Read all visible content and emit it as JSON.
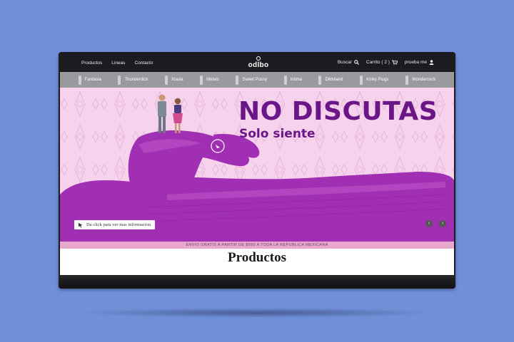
{
  "nav": {
    "links": [
      "Productos",
      "Lineas",
      "Contacto"
    ],
    "logo": "odlbo",
    "search_label": "Buscar",
    "cart_label": "Carrito ( 2 )",
    "user_label": "prueba me"
  },
  "categories": [
    "Fantasia",
    "Thunderdick",
    "Xtasia",
    "Metals",
    "Sweet Pussy",
    "Intima",
    "Dildoland",
    "Kinky Plugs",
    "Wondercock"
  ],
  "hero": {
    "headline": "NO DISCUTAS",
    "subhead": "Solo siente",
    "cta_label": "Da click para ver mas informacion",
    "prev_arrow": "‹",
    "next_arrow": "›"
  },
  "shipping_banner": "ENVIO GRATIS A PARTIR DE $599 A TODA LA REPUBLICA MEXICANA",
  "section_title": "Productos",
  "colors": {
    "background": "#6f8fd8",
    "nav_bg": "#1c1c20",
    "category_bar": "#9a9a9e",
    "hero_bg": "#f6d2ec",
    "headline": "#6b1688",
    "product_purple": "#a12fb3",
    "shipping_bar": "#e9a7cf"
  },
  "icons": {
    "search": "search-icon",
    "cart": "cart-icon",
    "user": "user-icon",
    "cursor": "cursor-icon"
  }
}
